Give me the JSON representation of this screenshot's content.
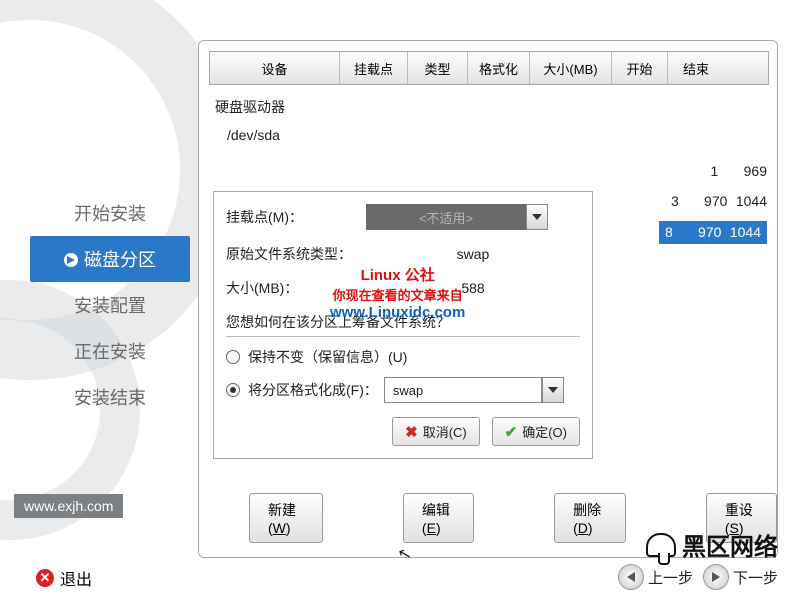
{
  "sidebar": {
    "items": [
      {
        "label": "开始安装"
      },
      {
        "label": "磁盘分区"
      },
      {
        "label": "安装配置"
      },
      {
        "label": "正在安装"
      },
      {
        "label": "安装结束"
      }
    ],
    "active_index": 1
  },
  "site_url": "www.exjh.com",
  "table": {
    "headers": [
      "设备",
      "挂载点",
      "类型",
      "格式化",
      "大小(MB)",
      "开始",
      "结束"
    ],
    "section": "硬盘驱动器",
    "device": "/dev/sda",
    "rows": [
      {
        "start": "1",
        "end": "969",
        "hl": false
      },
      {
        "size_prefix": "3",
        "start": "970",
        "end": "1044",
        "hl": false
      },
      {
        "size_prefix": "8",
        "start": "970",
        "end": "1044",
        "hl": true
      }
    ]
  },
  "dialog": {
    "mount_label": "挂载点(M)：",
    "mount_value": "<不适用>",
    "orig_fs_label": "原始文件系统类型：",
    "orig_fs_value": "swap",
    "size_label": "大小(MB)：",
    "size_value": "588",
    "prompt": "您想如何在该分区上筹备文件系统？",
    "keep_label": "保持不变（保留信息）(U)",
    "format_label": "将分区格式化成(F)：",
    "format_value": "swap",
    "cancel_label": "取消(C)",
    "ok_label": "确定(O)"
  },
  "footer": {
    "new": "新建(W)",
    "edit": "编辑(E)",
    "delete": "删除(D)",
    "reset": "重设(S)",
    "back": "上一步",
    "next": "下一步"
  },
  "exit_label": "退出",
  "watermark": {
    "l1": "Linux 公社",
    "l2": "你现在查看的文章来自",
    "l3": "www.Linuxidc.com"
  },
  "logo_text": "黑区网络"
}
